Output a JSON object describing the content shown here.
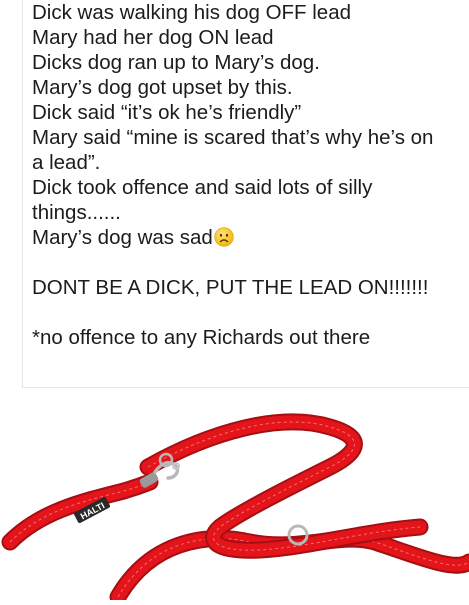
{
  "post": {
    "lines": [
      "Dick was walking his dog OFF lead",
      "Mary had her dog ON lead",
      "Dicks dog ran up to Mary’s dog.",
      "Mary’s dog got upset by this.",
      "Dick said “it’s ok he’s friendly”",
      "Mary said “mine is scared that’s why he’s on",
      "a lead”.",
      "Dick took offence and said lots of silly",
      "things......",
      "Mary’s dog was sad",
      "DONT BE A DICK, PUT THE LEAD ON!!!!!!!",
      "*no offence to any Richards out there"
    ],
    "emoji": "sad-face-emoji"
  },
  "image": {
    "brand_text": "HALTI",
    "colors": {
      "lead_red": "#e3151b",
      "lead_dark": "#a50e12",
      "stitch": "#ff6a6a",
      "metal": "#b8b8b8"
    }
  }
}
